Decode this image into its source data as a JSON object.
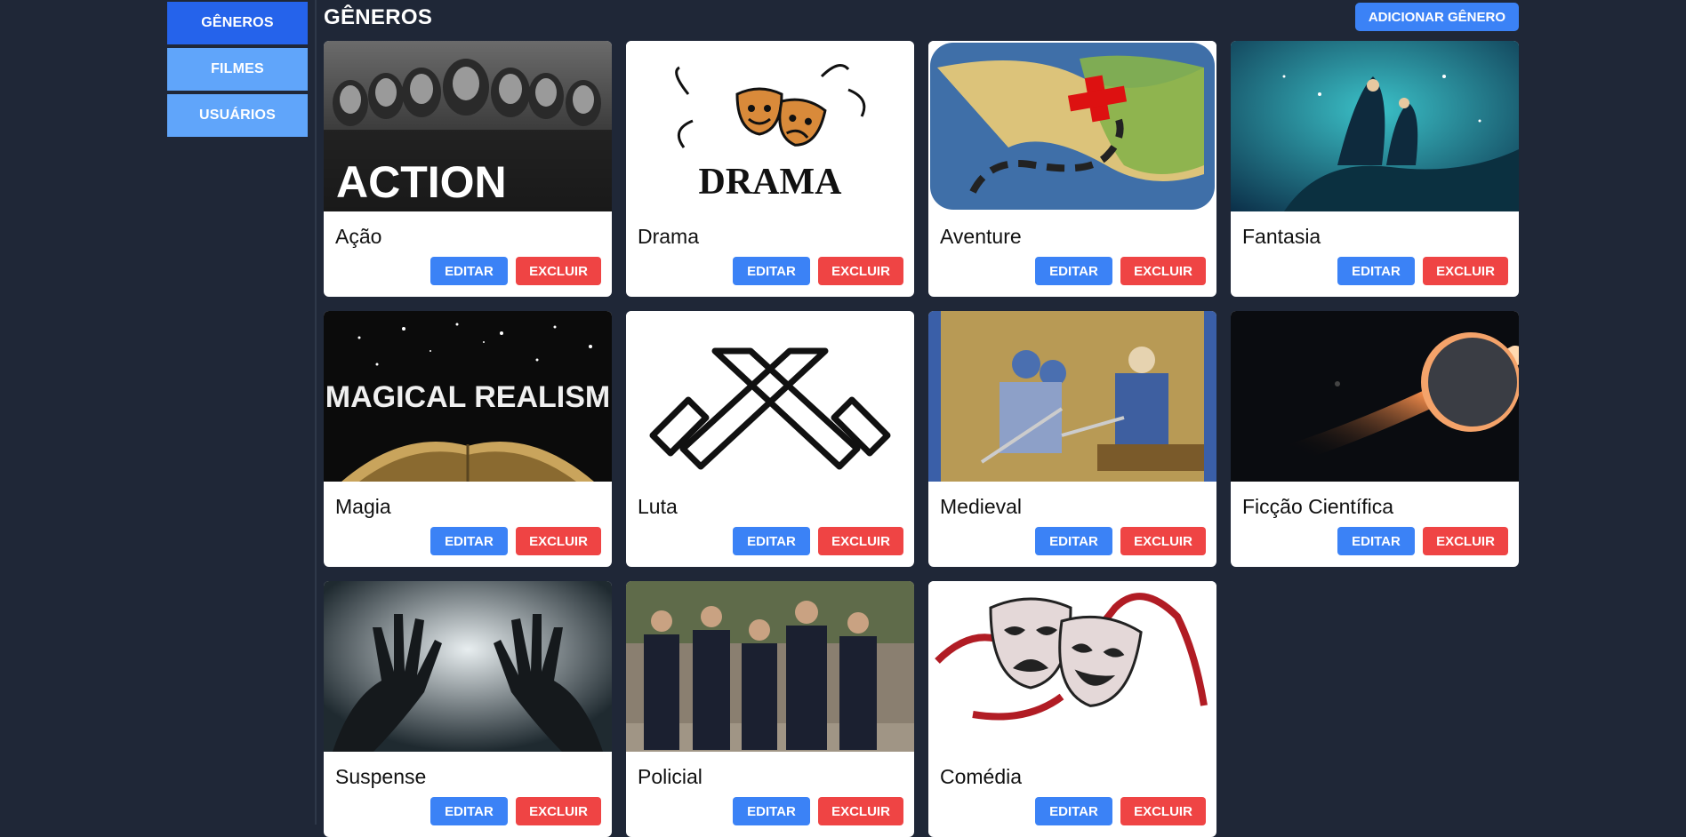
{
  "sidebar": {
    "items": [
      {
        "label": "GÊNEROS",
        "active": true
      },
      {
        "label": "FILMES",
        "active": false
      },
      {
        "label": "USUÁRIOS",
        "active": false
      }
    ]
  },
  "header": {
    "title": "GÊNEROS",
    "add_button_label": "ADICIONAR GÊNERO"
  },
  "card_actions": {
    "edit_label": "EDITAR",
    "delete_label": "EXCLUIR"
  },
  "genres": [
    {
      "name": "Ação",
      "image_text": "ACTION"
    },
    {
      "name": "Drama",
      "image_text": "DRAMA"
    },
    {
      "name": "Aventure"
    },
    {
      "name": "Fantasia"
    },
    {
      "name": "Magia",
      "image_text": "MAGICAL REALISM"
    },
    {
      "name": "Luta"
    },
    {
      "name": "Medieval"
    },
    {
      "name": "Ficção Científica"
    },
    {
      "name": "Suspense"
    },
    {
      "name": "Policial"
    },
    {
      "name": "Comédia"
    }
  ],
  "colors": {
    "background": "#1f2737",
    "nav_active": "#2563eb",
    "nav_inactive": "#60a5fa",
    "edit": "#3b82f6",
    "delete": "#ef4444"
  }
}
